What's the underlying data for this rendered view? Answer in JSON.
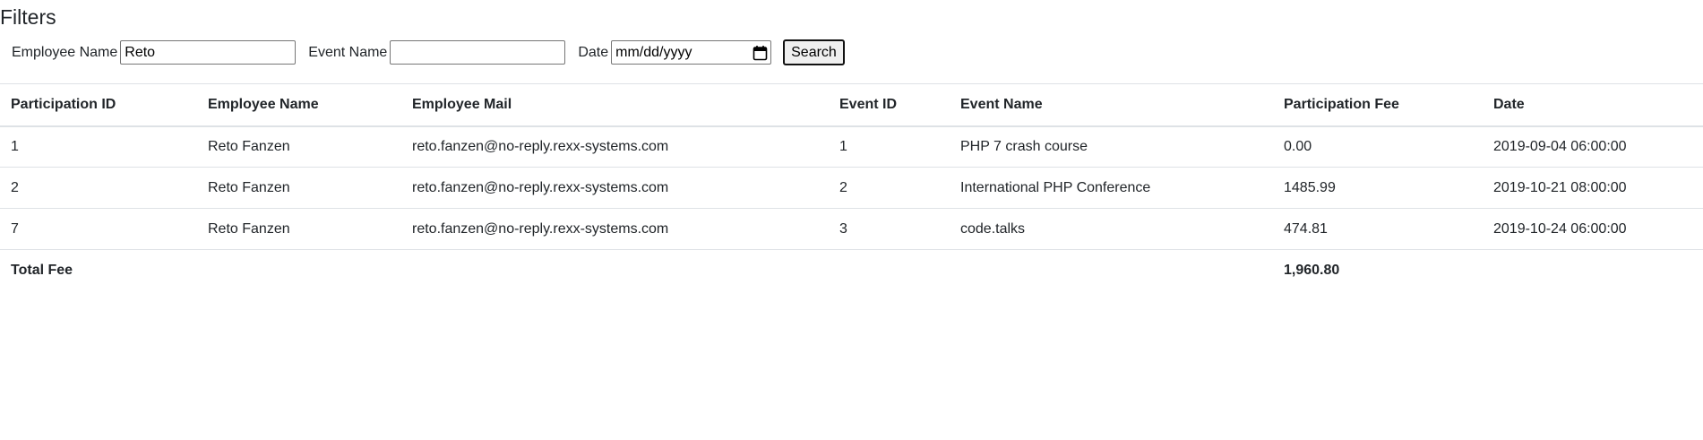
{
  "filters": {
    "title": "Filters",
    "employee_name_label": "Employee Name",
    "employee_name_value": "Reto",
    "event_name_label": "Event Name",
    "event_name_value": "",
    "date_label": "Date",
    "date_placeholder": "mm/dd/yyyy",
    "date_icon": "calendar-icon",
    "search_label": "Search"
  },
  "table": {
    "headers": [
      "Participation ID",
      "Employee Name",
      "Employee Mail",
      "Event ID",
      "Event Name",
      "Participation Fee",
      "Date"
    ],
    "rows": [
      [
        "1",
        "Reto Fanzen",
        "reto.fanzen@no-reply.rexx-systems.com",
        "1",
        "PHP 7 crash course",
        "0.00",
        "2019-09-04 06:00:00"
      ],
      [
        "2",
        "Reto Fanzen",
        "reto.fanzen@no-reply.rexx-systems.com",
        "2",
        "International PHP Conference",
        "1485.99",
        "2019-10-21 08:00:00"
      ],
      [
        "7",
        "Reto Fanzen",
        "reto.fanzen@no-reply.rexx-systems.com",
        "3",
        "code.talks",
        "474.81",
        "2019-10-24 06:00:00"
      ]
    ],
    "footer": {
      "label": "Total Fee",
      "total": "1,960.80"
    }
  }
}
